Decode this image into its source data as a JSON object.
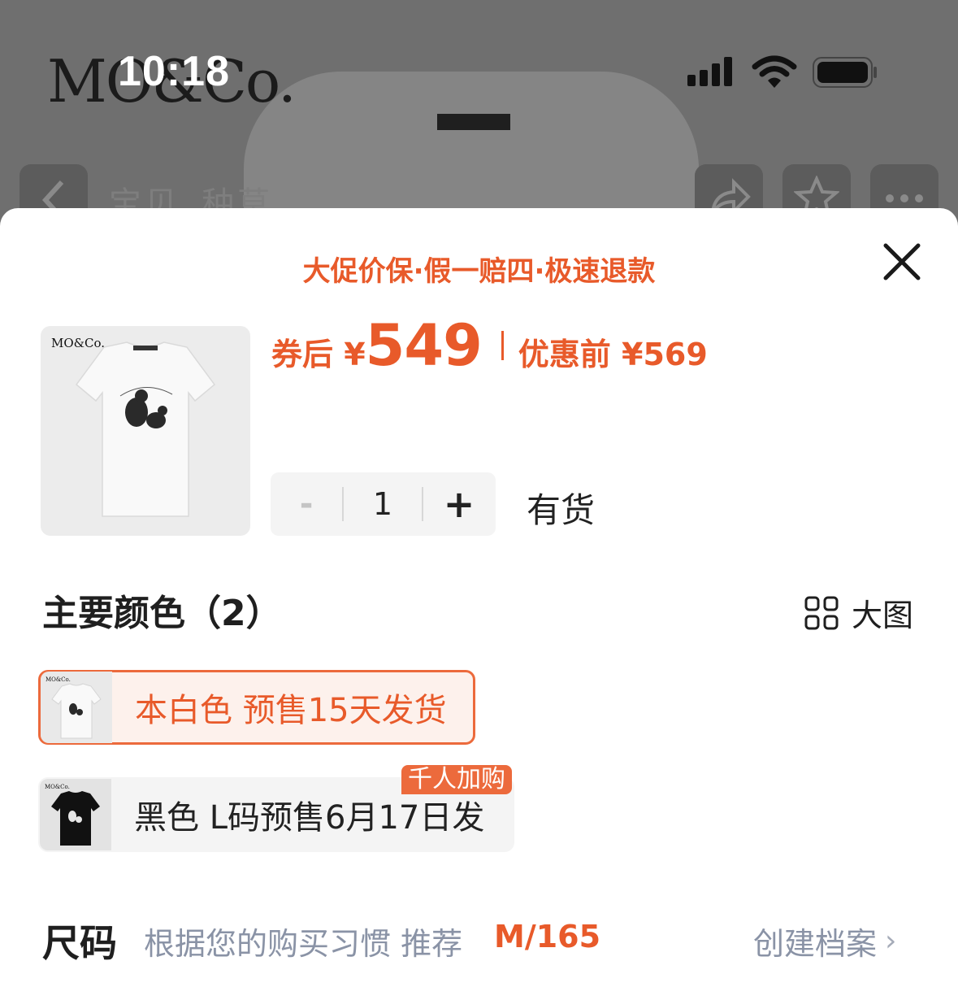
{
  "status_bar": {
    "time": "10:18"
  },
  "background": {
    "brand": "MO&Co.",
    "tabs": [
      "宝贝",
      "种草"
    ]
  },
  "sheet": {
    "promo": "大促价保·假一赔四·极速退款",
    "thumb_brand": "MO&Co.",
    "price": {
      "after_coupon_label": "券后 ¥",
      "after_coupon_value": "549",
      "before_label": "优惠前 ¥569"
    },
    "stepper": {
      "minus": "-",
      "quantity": "1",
      "plus": "+"
    },
    "stock": "有货",
    "colors_title": "主要颜色（2）",
    "big_view": "大图",
    "color_options": [
      {
        "label": "本白色 预售15天发货",
        "selected": true
      },
      {
        "label": "黑色 L码预售6月17日发",
        "badge": "千人加购",
        "selected": false
      }
    ],
    "size": {
      "title": "尺码",
      "hint": "根据您的购买习惯 推荐",
      "recommended": "M/165",
      "create_profile": "创建档案"
    }
  },
  "colors": {
    "accent": "#e85a2a",
    "selected_bg": "#fdf1ec",
    "muted": "#8a93a6"
  }
}
